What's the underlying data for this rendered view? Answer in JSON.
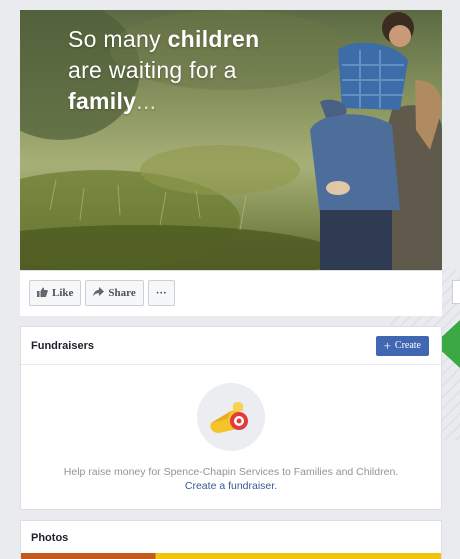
{
  "cover": {
    "line1_pre": "So many ",
    "line1_bold": "children",
    "line2": "are waiting for a",
    "line3_bold": "family",
    "line3_suffix": "..."
  },
  "actions": {
    "like_label": "Like",
    "share_label": "Share",
    "more_label": "···"
  },
  "fundraisers": {
    "title": "Fundraisers",
    "create_label": "Create",
    "description": "Help raise money for Spence-Chapin Services to Families and Children.",
    "link_text": "Create a fundraiser."
  },
  "photos": {
    "title": "Photos"
  },
  "colors": {
    "primary_blue": "#4267b2",
    "link_blue": "#385898",
    "accent_green": "#3aa845"
  },
  "icons": [
    "like-icon",
    "share-icon",
    "more-icon",
    "plus-icon",
    "fundraiser-icon"
  ]
}
